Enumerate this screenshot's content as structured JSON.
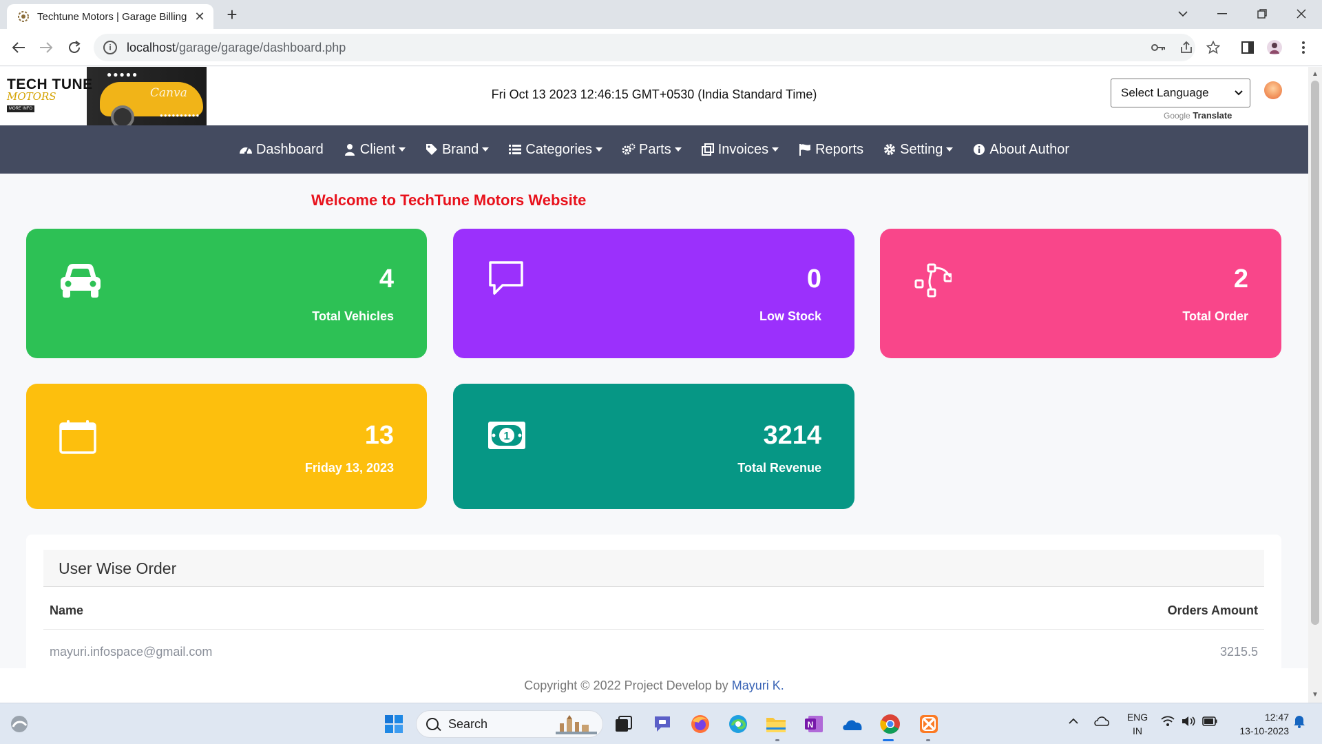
{
  "browser": {
    "tab_title": "Techtune Motors | Garage Billing",
    "url_host": "localhost",
    "url_path": "/garage/garage/dashboard.php"
  },
  "header": {
    "logo_line1": "TECH TUNE",
    "logo_line2": "MOTORS",
    "logo_badge": "MORE INFO",
    "logo_watermark": "Canva",
    "datetime": "Fri Oct 13 2023 12:46:15 GMT+0530 (India Standard Time)",
    "language_select": "Select Language",
    "google_label": "Google",
    "translate_label": "Translate"
  },
  "nav": {
    "items": [
      {
        "label": "Dashboard",
        "icon": "tachometer-icon",
        "dropdown": false
      },
      {
        "label": "Client",
        "icon": "user-icon",
        "dropdown": true
      },
      {
        "label": "Brand",
        "icon": "tag-icon",
        "dropdown": true
      },
      {
        "label": "Categories",
        "icon": "list-icon",
        "dropdown": true
      },
      {
        "label": "Parts",
        "icon": "cogs-icon",
        "dropdown": true
      },
      {
        "label": "Invoices",
        "icon": "clone-icon",
        "dropdown": true
      },
      {
        "label": "Reports",
        "icon": "flag-icon",
        "dropdown": false
      },
      {
        "label": "Setting",
        "icon": "gear-icon",
        "dropdown": true
      },
      {
        "label": "About Author",
        "icon": "info-circle-icon",
        "dropdown": false
      }
    ]
  },
  "welcome": "Welcome to TechTune Motors Website",
  "cards": [
    {
      "value": "4",
      "label": "Total Vehicles",
      "color": "#2dc155",
      "icon": "car-icon"
    },
    {
      "value": "0",
      "label": "Low Stock",
      "color": "#9b30fc",
      "icon": "comment-icon"
    },
    {
      "value": "2",
      "label": "Total Order",
      "color": "#f9468a",
      "icon": "bezier-curve-icon"
    },
    {
      "value": "13",
      "label": "Friday 13, 2023",
      "color": "#fdbf0d",
      "icon": "calendar-icon"
    },
    {
      "value": "3214",
      "label": "Total Revenue",
      "color": "#069785",
      "icon": "money-bill-icon"
    }
  ],
  "user_orders": {
    "title": "User Wise Order",
    "columns": [
      "Name",
      "Orders Amount"
    ],
    "rows": [
      {
        "name": "mayuri.infospace@gmail.com",
        "amount": "3215.5"
      }
    ]
  },
  "footer": {
    "text": "Copyright © 2022 Project Develop by",
    "author": "Mayuri K."
  },
  "taskbar": {
    "search_label": "Search",
    "lang_top": "ENG",
    "lang_bottom": "IN",
    "time": "12:47",
    "date": "13-10-2023"
  }
}
